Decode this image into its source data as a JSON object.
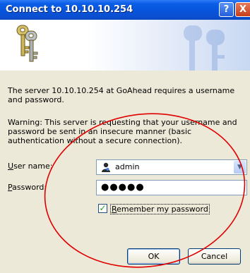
{
  "window": {
    "title": "Connect to 10.10.10.254",
    "help_glyph": "?",
    "close_glyph": "X"
  },
  "banner": {
    "image_icon": "keys-icon"
  },
  "message": {
    "server": "The server 10.10.10.254 at GoAhead requires a username and password.",
    "warning": "Warning: This server is requesting that your username and password be sent in an insecure manner (basic authentication without a secure connection)."
  },
  "form": {
    "username": {
      "label_prefix": "U",
      "label_rest": "ser name:",
      "value": "admin",
      "icon": "user-icon"
    },
    "password": {
      "label_prefix": "P",
      "label_rest": "assword:",
      "value": "●●●●●"
    },
    "remember": {
      "checked": true,
      "label_prefix": "R",
      "label_rest": "emember my password"
    }
  },
  "buttons": {
    "ok": "OK",
    "cancel": "Cancel"
  },
  "annotation": {
    "color": "#e00000"
  },
  "colors": {
    "titlebar": "#0854dc",
    "dialog_bg": "#ece9d8"
  }
}
